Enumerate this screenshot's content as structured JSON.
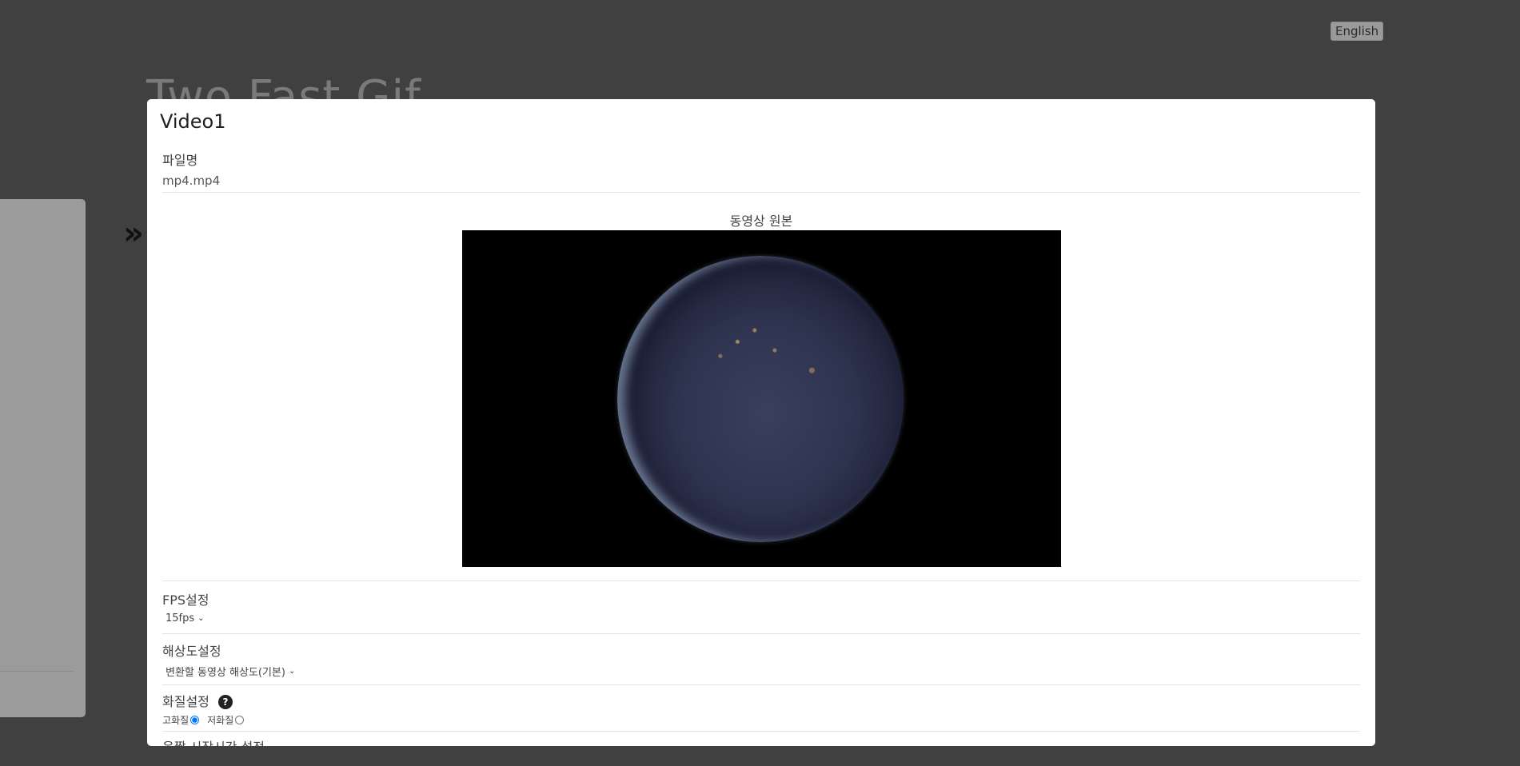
{
  "header": {
    "language_button": "English",
    "background_title": "Two Fast Gif"
  },
  "modal": {
    "title": "Video1",
    "filename_label": "파일명",
    "filename_value": "mp4.mp4",
    "preview_label": "동영상 원본",
    "fps": {
      "label": "FPS설정",
      "selected": "15fps"
    },
    "resolution": {
      "label": "해상도설정",
      "selected": "변환할 동영상 해상도(기본)"
    },
    "quality": {
      "label": "화질설정",
      "help": "?",
      "options": [
        {
          "label": "고화질",
          "checked": true
        },
        {
          "label": "저화질",
          "checked": false
        }
      ]
    },
    "next_section_label": "움짤 시작시간 설정"
  },
  "icons": {
    "expand": "double-chevron-right-icon",
    "dropdown": "chevron-down-icon",
    "help": "question-circle-icon"
  }
}
